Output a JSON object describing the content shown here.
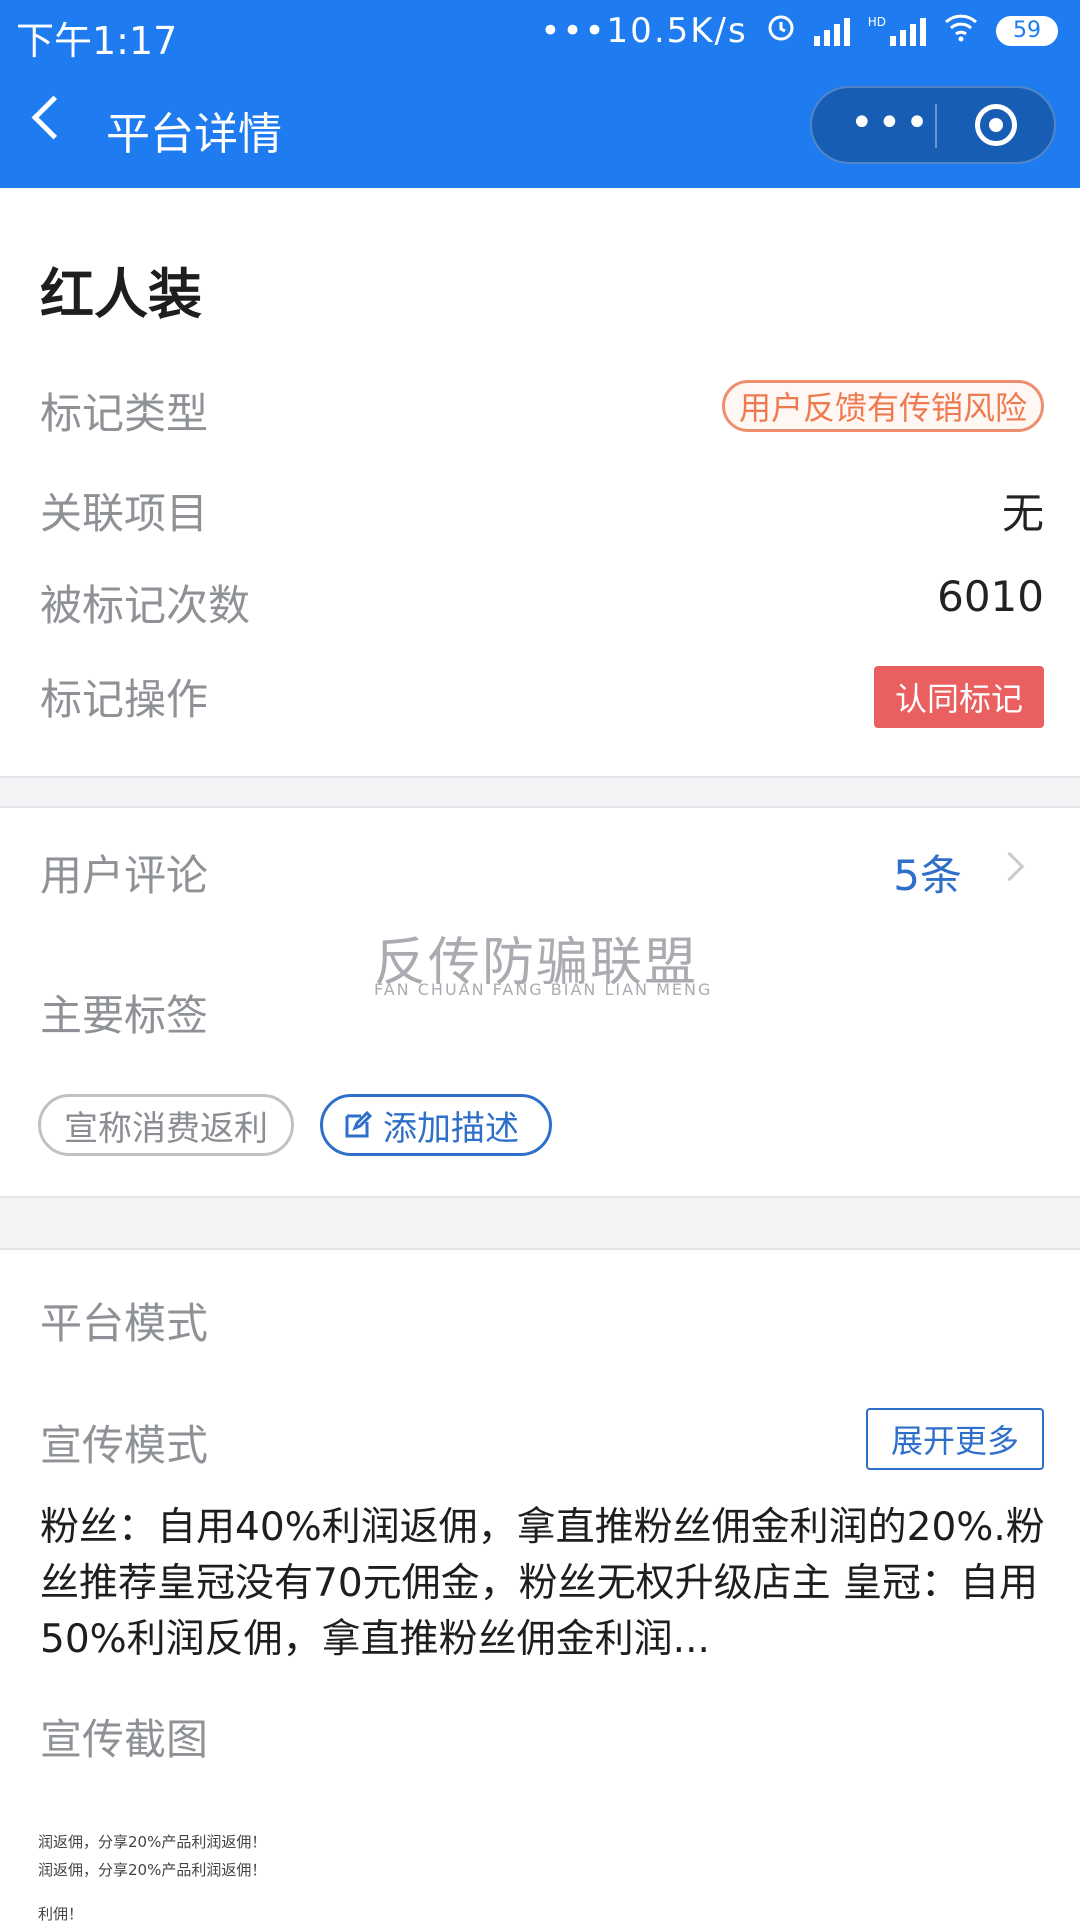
{
  "status_bar": {
    "time": "下午1:17",
    "net_speed": "•••10.5K/s",
    "hd_label": "HD",
    "battery": "59"
  },
  "nav": {
    "title": "平台详情"
  },
  "platform": {
    "name": "红人装",
    "rows": {
      "mark_type_label": "标记类型",
      "mark_type_value": "用户反馈有传销风险",
      "related_label": "关联项目",
      "related_value": "无",
      "marked_count_label": "被标记次数",
      "marked_count_value": "6010",
      "mark_action_label": "标记操作",
      "mark_action_button": "认同标记"
    }
  },
  "comments": {
    "label": "用户评论",
    "count": "5条"
  },
  "watermark": {
    "cn": "反传防骗联盟",
    "en": "FAN CHUAN FANG BIAN LIAN MENG"
  },
  "tags": {
    "label": "主要标签",
    "items": [
      "宣称消费返利"
    ],
    "add_label": "添加描述"
  },
  "mode": {
    "section_label": "平台模式",
    "promo_label": "宣传模式",
    "expand_label": "展开更多",
    "promo_text": "粉丝：自用40%利润返佣，拿直推粉丝佣金利润的20%.粉丝推荐皇冠没有70元佣金，粉丝无权升级店主 皇冠：自用50%利润反佣，拿直推粉丝佣金利润...",
    "screenshot_label": "宣传截图",
    "screenshot_lines": [
      "润返佣，分享20%产品利润返佣！",
      "润返佣，分享20%产品利润返佣！",
      "利佣！"
    ]
  },
  "colors": {
    "header_bg": "#1f7cf0",
    "accent_blue": "#2d6fc9",
    "warning_orange": "#ef7a4f",
    "danger_red": "#ea5f60"
  }
}
